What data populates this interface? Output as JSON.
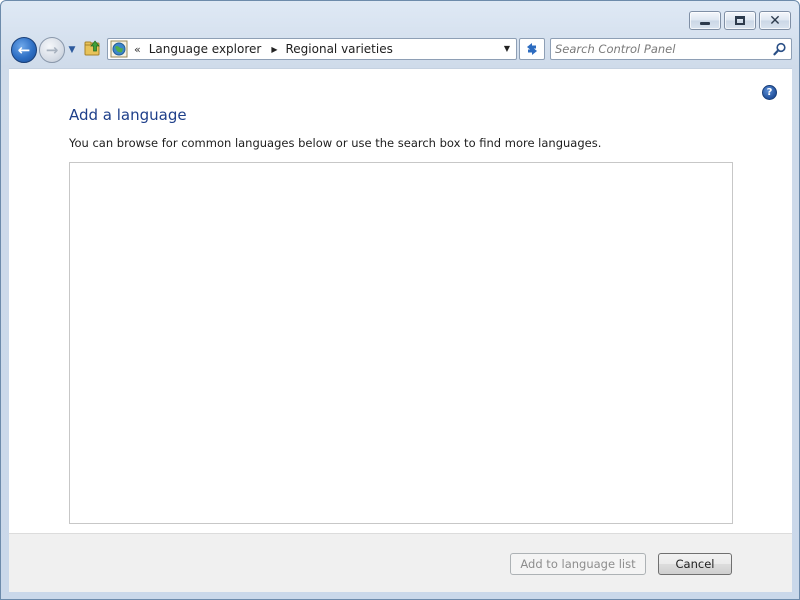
{
  "window": {
    "caption_buttons": {
      "minimize_icon": "minimize-icon",
      "maximize_icon": "maximize-icon",
      "close_glyph": "✕"
    }
  },
  "toolbar": {
    "back_glyph": "←",
    "forward_glyph": "→",
    "history_glyph": "▼",
    "address": {
      "overflow": "«",
      "breadcrumbs": [
        {
          "label": "Language explorer"
        },
        {
          "label": "Regional varieties"
        }
      ],
      "separator": "▶",
      "dropdown_glyph": "▼"
    },
    "search": {
      "placeholder": "Search Control Panel"
    }
  },
  "main": {
    "help_glyph": "?",
    "title": "Add a language",
    "description": "You can browse for common languages below or use the search box to find more languages.",
    "language_list": []
  },
  "footer": {
    "add_button": {
      "label": "Add to language list",
      "enabled": false
    },
    "cancel_button": {
      "label": "Cancel",
      "enabled": true
    }
  },
  "colors": {
    "title": "#1e3f8a",
    "frame": "#cad8ea",
    "footer": "#f0f0f0"
  }
}
